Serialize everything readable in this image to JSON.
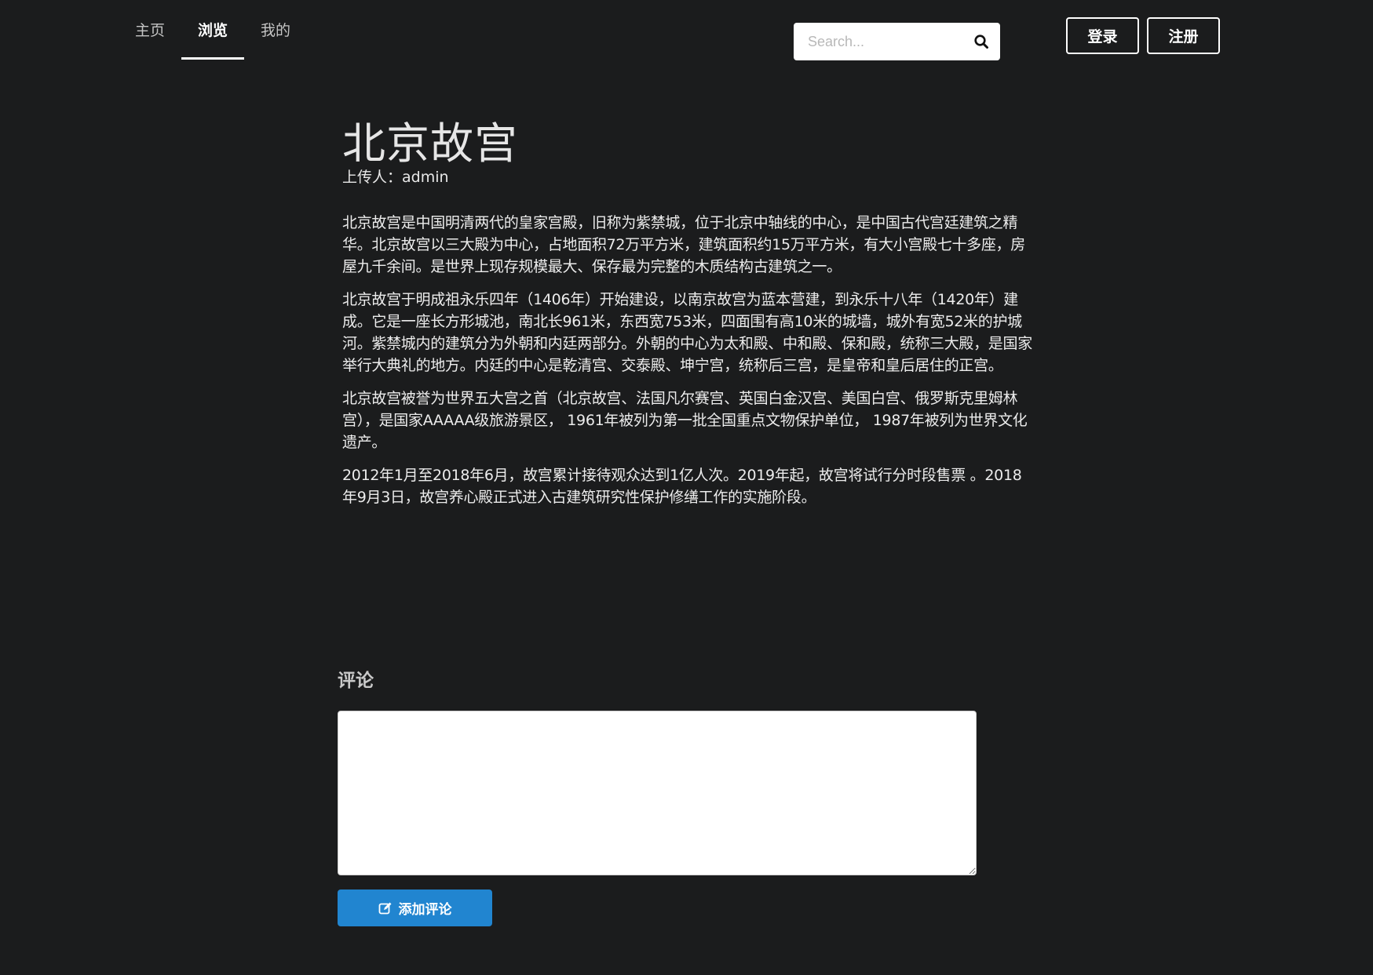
{
  "menu": {
    "tabs": [
      {
        "label": "主页",
        "active": false
      },
      {
        "label": "浏览",
        "active": true
      },
      {
        "label": "我的",
        "active": false
      }
    ],
    "search": {
      "placeholder": "Search...",
      "value": "",
      "icon": "search-icon"
    },
    "login_label": "登录",
    "register_label": "注册"
  },
  "article": {
    "title": "北京故宫",
    "uploader": "上传人：admin",
    "paragraphs": [
      "北京故宫是中国明清两代的皇家宫殿，旧称为紫禁城，位于北京中轴线的中心，是中国古代宫廷建筑之精华。北京故宫以三大殿为中心，占地面积72万平方米，建筑面积约15万平方米，有大小宫殿七十多座，房屋九千余间。是世界上现存规模最大、保存最为完整的木质结构古建筑之一。",
      "北京故宫于明成祖永乐四年（1406年）开始建设，以南京故宫为蓝本营建，到永乐十八年（1420年）建成。它是一座长方形城池，南北长961米，东西宽753米，四面围有高10米的城墙，城外有宽52米的护城河。紫禁城内的建筑分为外朝和内廷两部分。外朝的中心为太和殿、中和殿、保和殿，统称三大殿，是国家举行大典礼的地方。内廷的中心是乾清宫、交泰殿、坤宁宫，统称后三宫，是皇帝和皇后居住的正宫。",
      "北京故宫被誉为世界五大宫之首（北京故宫、法国凡尔赛宫、英国白金汉宫、美国白宫、俄罗斯克里姆林宫），是国家AAAAA级旅游景区， 1961年被列为第一批全国重点文物保护单位， 1987年被列为世界文化遗产。",
      "2012年1月至2018年6月，故宫累计接待观众达到1亿人次。2019年起，故宫将试行分时段售票 。2018年9月3日，故宫养心殿正式进入古建筑研究性保护修缮工作的实施阶段。"
    ]
  },
  "comments": {
    "title": "评论",
    "textarea_value": "",
    "submit_label": "添加评论",
    "submit_icon": "edit-icon"
  },
  "colors": {
    "background": "#1b1c1d",
    "primary_button": "#2185d0"
  }
}
